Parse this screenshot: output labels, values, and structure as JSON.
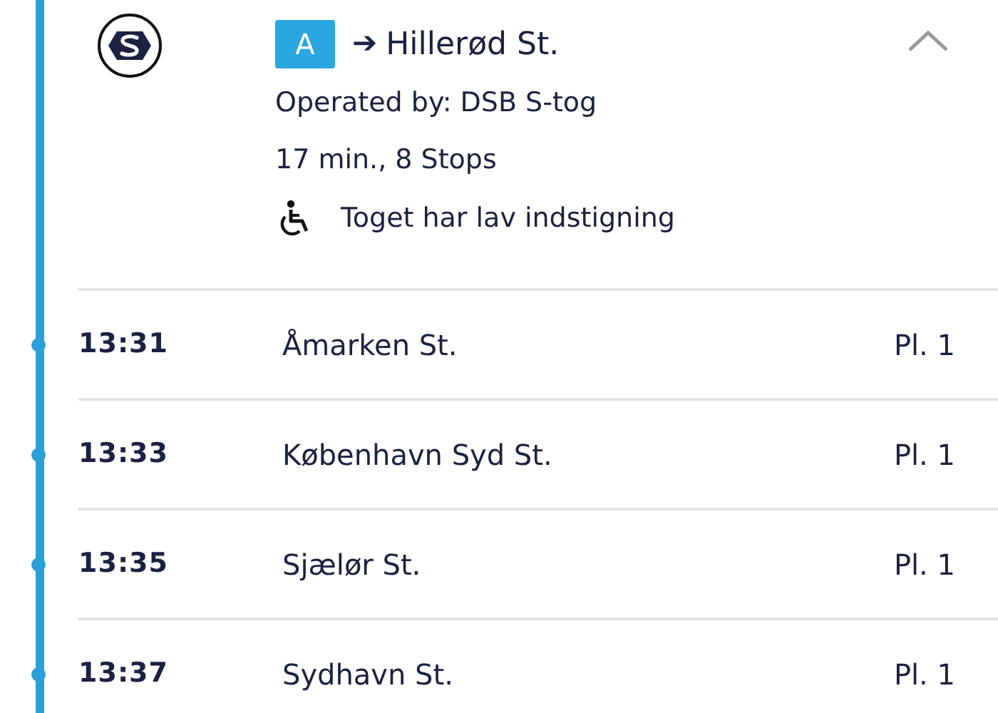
{
  "leg": {
    "line_badge": "A",
    "arrow": "➔",
    "destination": "Hillerød St.",
    "operator": "Operated by: DSB S-tog",
    "summary": "17 min., 8 Stops",
    "accessibility": "Toget har lav indstigning",
    "expanded": true
  },
  "stops": [
    {
      "time": "13:31",
      "name": "Åmarken St.",
      "platform": "Pl. 1"
    },
    {
      "time": "13:33",
      "name": "København Syd St.",
      "platform": "Pl. 1"
    },
    {
      "time": "13:35",
      "name": "Sjælør St.",
      "platform": "Pl. 1"
    },
    {
      "time": "13:37",
      "name": "Sydhavn St.",
      "platform": "Pl. 1"
    }
  ]
}
